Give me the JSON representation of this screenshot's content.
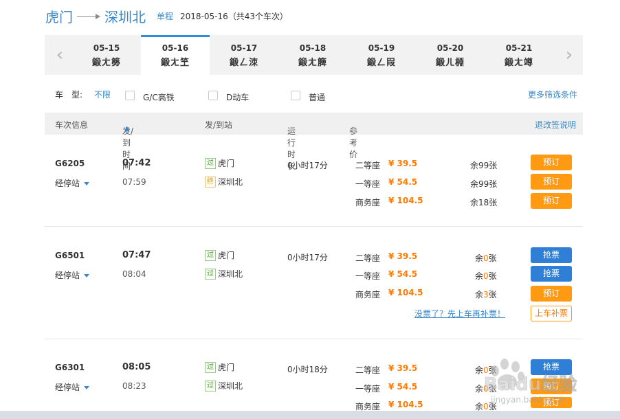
{
  "route": {
    "from": "虎门",
    "to": "深圳北",
    "trip_type": "单程",
    "info": "2018-05-16（共43个车次）"
  },
  "dates": [
    {
      "date": "05-15",
      "week": "鍛ㄤ簩",
      "active": false
    },
    {
      "date": "05-16",
      "week": "鍛ㄤ笁",
      "active": true
    },
    {
      "date": "05-17",
      "week": "鍛ㄥ洓",
      "active": false
    },
    {
      "date": "05-18",
      "week": "鍛ㄤ簲",
      "active": false
    },
    {
      "date": "05-19",
      "week": "鍛ㄥ叚",
      "active": false
    },
    {
      "date": "05-20",
      "week": "鍛ㄦ棩",
      "active": false
    },
    {
      "date": "05-21",
      "week": "鍛ㄤ竴",
      "active": false
    }
  ],
  "filter": {
    "label": "车　型:",
    "value": "不限",
    "options": [
      "G/C高铁",
      "D动车",
      "普通"
    ],
    "more": "更多筛选条件"
  },
  "table_header": {
    "train_info": "车次信息",
    "time": "发/到时间",
    "station": "发/到站",
    "duration": "运行时长",
    "price": "参考价",
    "refund": "退改签说明"
  },
  "trains": [
    {
      "no": "G6205",
      "stops": "经停站",
      "dep": "07:42",
      "arr": "07:59",
      "from_tag": "过",
      "from": "虎门",
      "to_tag": "终",
      "to": "深圳北",
      "duration": "0小时17分",
      "seats": [
        {
          "name": "二等座",
          "price": "¥ 39.5",
          "left": "余99张",
          "button": "预订"
        },
        {
          "name": "一等座",
          "price": "¥ 54.5",
          "left": "余99张",
          "button": "预订"
        },
        {
          "name": "商务座",
          "price": "¥ 104.5",
          "left": "余18张",
          "button": "预订"
        }
      ]
    },
    {
      "no": "G6501",
      "stops": "经停站",
      "dep": "07:47",
      "arr": "08:04",
      "from_tag": "过",
      "from": "虎门",
      "to_tag": "过",
      "to": "深圳北",
      "duration": "0小时17分",
      "seats": [
        {
          "name": "二等座",
          "price": "¥ 39.5",
          "left_a": "余",
          "left_z": "0",
          "left_b": "张",
          "button": "抢票"
        },
        {
          "name": "一等座",
          "price": "¥ 54.5",
          "left_a": "余",
          "left_z": "0",
          "left_b": "张",
          "button": "抢票"
        },
        {
          "name": "商务座",
          "price": "¥ 104.5",
          "left_a": "余",
          "left_z": "3",
          "left_b": "张",
          "button": "预订"
        }
      ],
      "nobuy": "没票了？先上车再补票！",
      "board_btn": "上车补票"
    },
    {
      "no": "G6301",
      "stops": "经停站",
      "dep": "08:05",
      "arr": "08:23",
      "from_tag": "过",
      "from": "虎门",
      "to_tag": "过",
      "to": "深圳北",
      "duration": "0小时18分",
      "seats": [
        {
          "name": "二等座",
          "price": "¥ 39.5",
          "left_a": "余",
          "left_z": "0",
          "left_b": "张",
          "button": "抢票"
        },
        {
          "name": "一等座",
          "price": "¥ 54.5",
          "left_a": "余",
          "left_z": "0",
          "left_b": "张",
          "button": "预订"
        },
        {
          "name": "商务座",
          "price": "¥ 104.5",
          "left_a": "余",
          "left_z": "0",
          "left_b": "张",
          "button": "预订"
        }
      ]
    }
  ],
  "watermark": {
    "brand": "Baidu经验",
    "url": "jingyan.baidu.com"
  },
  "colors": {
    "accent": "#3a88c9",
    "price": "#ff7a00",
    "book": "#ff9a12",
    "grab": "#2f7fd6"
  },
  "icons": {
    "prev": "chevron-left-icon",
    "next": "chevron-right-icon",
    "sort_active": "arrow-up-icon",
    "sort": "arrow-up-gray-icon",
    "caret": "caret-down-icon"
  }
}
